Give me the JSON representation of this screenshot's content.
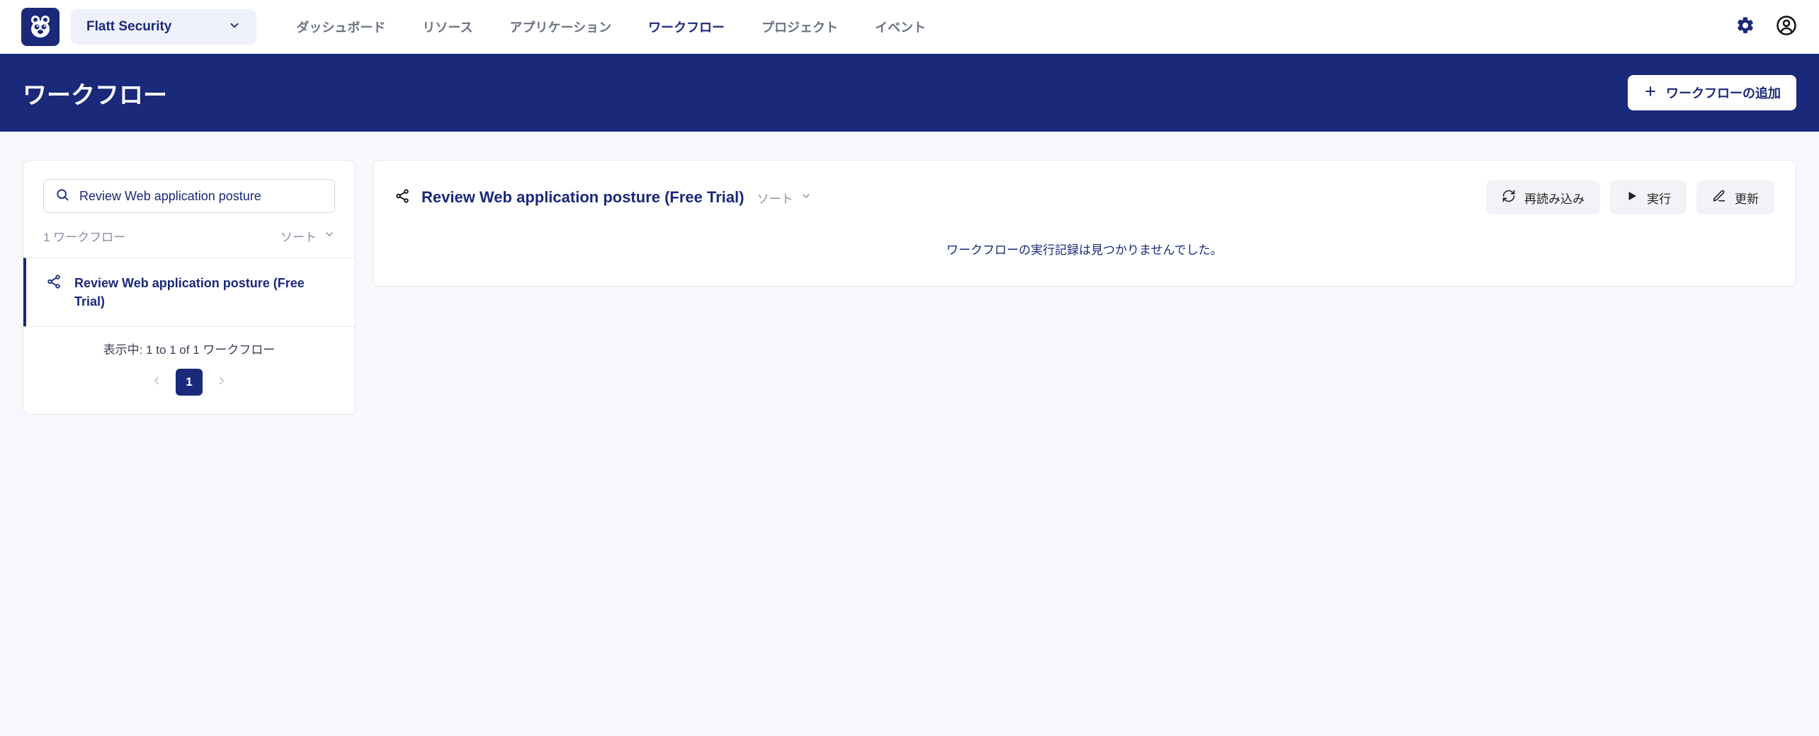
{
  "header": {
    "org_name": "Flatt Security",
    "nav": {
      "dashboard": "ダッシュボード",
      "resources": "リソース",
      "applications": "アプリケーション",
      "workflows": "ワークフロー",
      "projects": "プロジェクト",
      "events": "イベント"
    }
  },
  "page": {
    "title": "ワークフロー",
    "add_button": "ワークフローの追加"
  },
  "sidebar": {
    "search_value": "Review Web application posture",
    "count_label": "1 ワークフロー",
    "sort_label": "ソート",
    "items": [
      {
        "label": "Review Web application posture (Free Trial)"
      }
    ],
    "pager": {
      "showing": "表示中: 1 to 1 of 1 ワークフロー",
      "current": "1"
    }
  },
  "main": {
    "title": "Review Web application posture (Free Trial)",
    "sort_label": "ソート",
    "buttons": {
      "reload": "再読み込み",
      "run": "実行",
      "update": "更新"
    },
    "empty_message": "ワークフローの実行記録は見つかりませんでした。"
  }
}
